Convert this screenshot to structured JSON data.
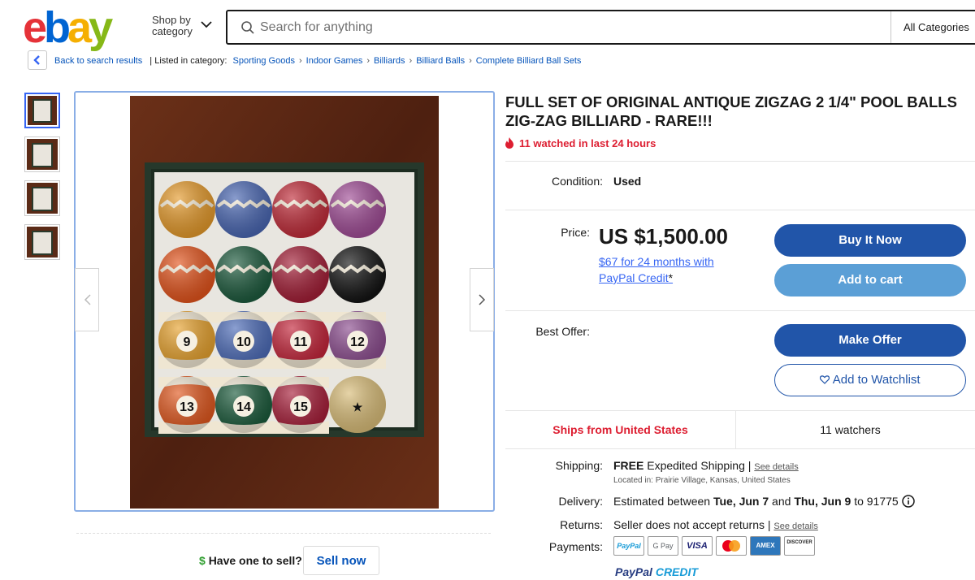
{
  "header": {
    "logo": {
      "e": "e",
      "b": "b",
      "a": "a",
      "y": "y"
    },
    "shop_by_line1": "Shop by",
    "shop_by_line2": "category",
    "search_placeholder": "Search for anything",
    "all_categories": "All Categories"
  },
  "breadcrumb": {
    "back_label": "Back to search results",
    "listed_in": "| Listed in category:",
    "items": [
      "Sporting Goods",
      "Indoor Games",
      "Billiards",
      "Billiard Balls",
      "Complete Billiard Ball Sets"
    ]
  },
  "gallery": {
    "thumbnail_count": 4,
    "selected_index": 0,
    "balls": [
      {
        "number": "",
        "color": "#e49a2c",
        "stripe": "#fff"
      },
      {
        "number": "",
        "color": "#4a67b2",
        "stripe": "#fff"
      },
      {
        "number": "",
        "color": "#c02d3a",
        "stripe": "#fff"
      },
      {
        "number": "",
        "color": "#a04d96",
        "stripe": "#fff"
      },
      {
        "number": "",
        "color": "#e2541d",
        "stripe": "#fff"
      },
      {
        "number": "",
        "color": "#1e5b3e",
        "stripe": "#fff"
      },
      {
        "number": "",
        "color": "#a31f37",
        "stripe": "#fff"
      },
      {
        "number": "",
        "color": "#141414",
        "stripe": "#fff"
      },
      {
        "number": "9",
        "color": "#e6a22f",
        "stripe": "#efe6d2"
      },
      {
        "number": "10",
        "color": "#4d6cb8",
        "stripe": "#efe6d2"
      },
      {
        "number": "11",
        "color": "#c3253a",
        "stripe": "#efe6d2"
      },
      {
        "number": "12",
        "color": "#8c4d8f",
        "stripe": "#efe6d2"
      },
      {
        "number": "13",
        "color": "#e0581f",
        "stripe": "#efe6d2"
      },
      {
        "number": "14",
        "color": "#1c5b3c",
        "stripe": "#efe6d2"
      },
      {
        "number": "15",
        "color": "#a71f3a",
        "stripe": "#efe6d2"
      },
      {
        "number": "★",
        "color": "#d9bd79",
        "stripe": "#d9bd79"
      }
    ]
  },
  "sell": {
    "dollar": "$",
    "question": "Have one to sell?",
    "button": "Sell now"
  },
  "listing": {
    "title": "FULL SET OF ORIGINAL ANTIQUE ZIGZAG 2 1/4\" POOL BALLS ZIG-ZAG BILLIARD - RARE!!!",
    "watched": "11 watched in last 24 hours",
    "condition_label": "Condition:",
    "condition_value": "Used",
    "price_label": "Price:",
    "price_value": "US $1,500.00",
    "paypal_credit_offer": "$67 for 24 months with PayPal Credit",
    "paypal_credit_star": "*",
    "buy_now": "Buy It Now",
    "add_to_cart": "Add to cart",
    "best_offer_label": "Best Offer:",
    "make_offer": "Make Offer",
    "add_to_watchlist": "Add to Watchlist",
    "ships_from": "Ships from United States",
    "watchers": "11 watchers",
    "shipping_label": "Shipping:",
    "shipping_free": "FREE",
    "shipping_method": " Expedited Shipping | ",
    "see_details": "See details",
    "location": "Located in: Prairie Village, Kansas, United States",
    "delivery_label": "Delivery:",
    "delivery_prefix": "Estimated between ",
    "delivery_start": "Tue, Jun 7",
    "delivery_and": " and ",
    "delivery_end": "Thu, Jun 9",
    "delivery_to": " to 91775",
    "returns_label": "Returns:",
    "returns_value": "Seller does not accept returns | ",
    "payments_label": "Payments:",
    "payment_methods": [
      "PayPal",
      "G Pay",
      "VISA",
      "",
      "AMEX",
      "DISCOVER"
    ],
    "paypal_credit_logo_a": "PayPal",
    "paypal_credit_logo_b": " CREDIT"
  },
  "colors": {
    "brand_blue": "#2155a9",
    "light_blue": "#5b9fd6",
    "alert_red": "#dd1e31",
    "link_blue": "#0654ba"
  }
}
